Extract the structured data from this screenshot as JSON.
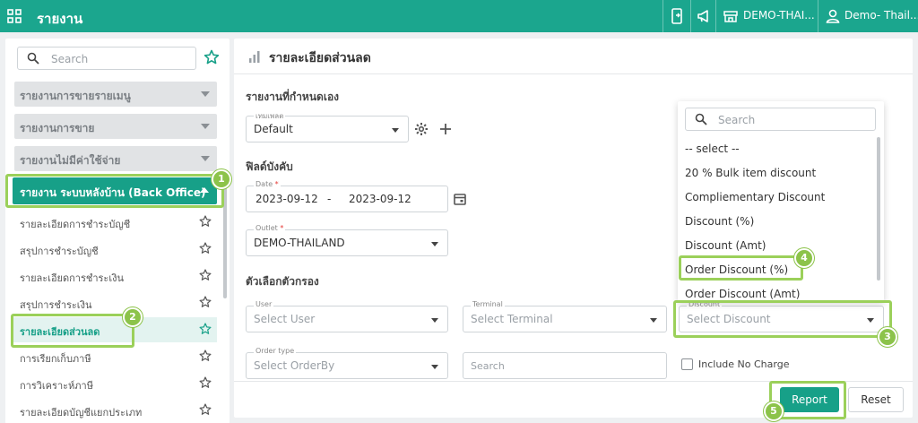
{
  "topbar": {
    "title": "รายงาน",
    "store_label": "DEMO-THAI...",
    "user_label": "Demo- Thail..."
  },
  "sidebar": {
    "search_placeholder": "Search",
    "categories": [
      {
        "label": "รายงานการขายรายเมนู"
      },
      {
        "label": "รายงานการขาย"
      },
      {
        "label": "รายงานไม่มีค่าใช้จ่าย"
      }
    ],
    "active_category": "รายงาน ระบบหลังบ้าน (Back Office)",
    "items": [
      {
        "label": "รายละเอียดการชำระบัญชี"
      },
      {
        "label": "สรุปการชำระบัญชี"
      },
      {
        "label": "รายละเอียดการชำระเงิน"
      },
      {
        "label": "สรุปการชำระเงิน"
      },
      {
        "label": "รายละเอียดส่วนลด"
      },
      {
        "label": "การเรียกเก็บภาษี"
      },
      {
        "label": "การวิเคราะห์ภาษี"
      },
      {
        "label": "รายละเอียดบัญชีแยกประเภท"
      }
    ]
  },
  "main": {
    "page_title": "รายละเอียดส่วนลด",
    "custom_report_title": "รายงานที่กำหนดเอง",
    "template_label": "เทมเพลต",
    "template_value": "Default",
    "required_fields_title": "ฟิลด์บังคับ",
    "date_label": "Date",
    "date_from": "2023-09-12",
    "date_sep": "-",
    "date_to": "2023-09-12",
    "outlet_label": "Outlet",
    "outlet_value": "DEMO-THAILAND",
    "filter_title": "ตัวเลือกตัวกรอง",
    "user_label": "User",
    "user_placeholder": "Select User",
    "terminal_label": "Terminal",
    "terminal_placeholder": "Select Terminal",
    "discount_label": "Discount",
    "discount_placeholder": "Select Discount",
    "ordertype_label": "Order type",
    "ordertype_placeholder": "Select OrderBy",
    "search_placeholder": "Search",
    "include_no_charge": "Include No Charge",
    "report_button": "Report",
    "reset_button": "Reset",
    "required_mark": "*"
  },
  "discount_dropdown": {
    "search_placeholder": "Search",
    "options": [
      {
        "label": "-- select --"
      },
      {
        "label": "20 % Bulk item discount"
      },
      {
        "label": "Compliementary Discount"
      },
      {
        "label": "Discount (%)"
      },
      {
        "label": "Discount (Amt)"
      },
      {
        "label": "Order Discount (%)"
      },
      {
        "label": "Order Discount (Amt)"
      }
    ]
  },
  "annotations": [
    "1",
    "2",
    "3",
    "4",
    "5"
  ],
  "colors": {
    "brand": "#1ba68e",
    "highlight": "#9bd05a",
    "badge": "#8cc34a"
  }
}
